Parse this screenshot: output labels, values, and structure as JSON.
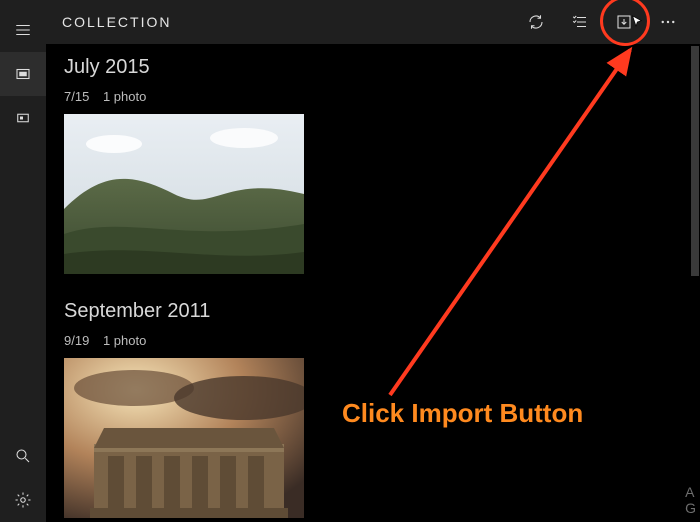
{
  "header": {
    "title": "COLLECTION",
    "refresh_name": "refresh",
    "select_name": "select",
    "import_name": "import",
    "more_name": "more"
  },
  "sidebar": {
    "items": [
      {
        "name": "menu"
      },
      {
        "name": "collection",
        "active": true
      },
      {
        "name": "albums"
      }
    ],
    "bottom": [
      {
        "name": "search"
      },
      {
        "name": "settings"
      }
    ]
  },
  "groups": [
    {
      "title": "July 2015",
      "date": "7/15",
      "count_label": "1 photo"
    },
    {
      "title": "September 2011",
      "date": "9/19",
      "count_label": "1 photo"
    }
  ],
  "annotation": {
    "callout": "Click Import Button"
  },
  "rpanel": {
    "line1": "A",
    "line2": "G"
  }
}
